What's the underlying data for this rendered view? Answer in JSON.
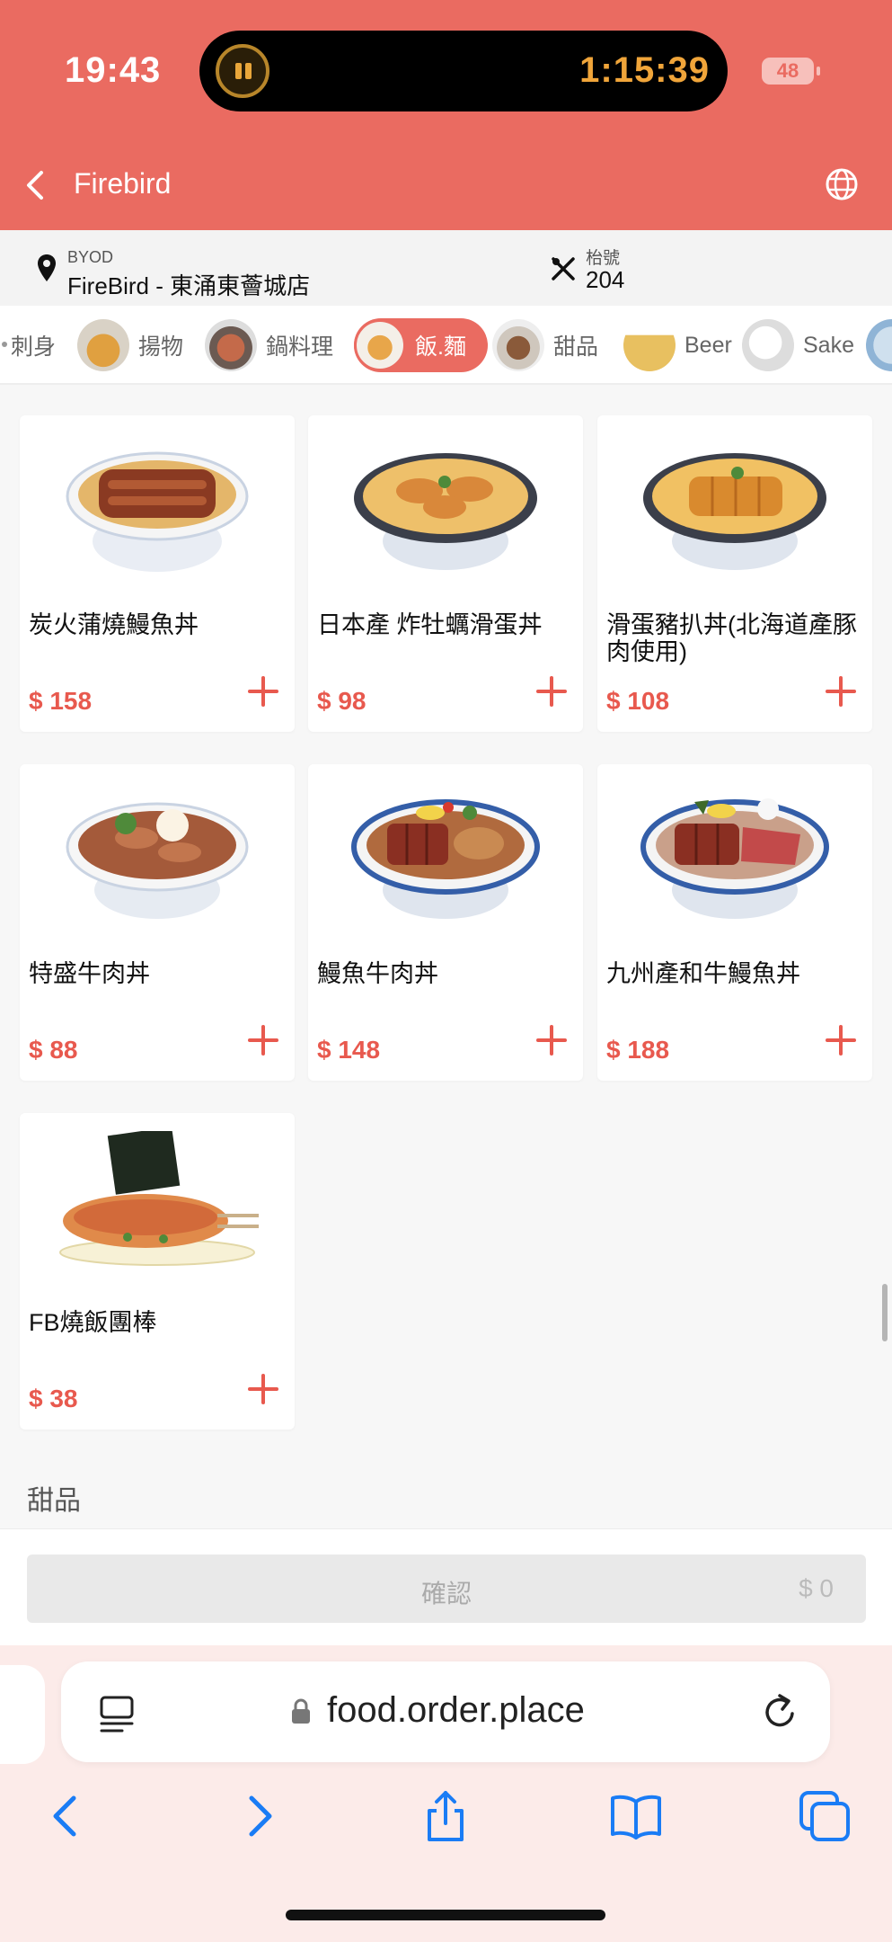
{
  "status_bar": {
    "time": "19:43",
    "timer": "1:15:39",
    "battery": "48"
  },
  "header": {
    "title": "Firebird"
  },
  "info": {
    "byod_label": "BYOD",
    "store_name": "FireBird - 東涌東薈城店",
    "table_label": "枱號",
    "table_number": "204"
  },
  "categories": [
    {
      "label": "刺身",
      "active": false
    },
    {
      "label": "揚物",
      "active": false
    },
    {
      "label": "鍋料理",
      "active": false
    },
    {
      "label": "飯.麵",
      "active": true
    },
    {
      "label": "甜品",
      "active": false
    },
    {
      "label": "Beer",
      "active": false
    },
    {
      "label": "Sake",
      "active": false
    }
  ],
  "products": [
    {
      "name": "炭火蒲燒鰻魚丼",
      "price": "$ 158"
    },
    {
      "name": "日本產 炸牡蠣滑蛋丼",
      "price": "$ 98"
    },
    {
      "name": "滑蛋豬扒丼(北海道產豚肉使用)",
      "price": "$ 108"
    },
    {
      "name": "特盛牛肉丼",
      "price": "$ 88"
    },
    {
      "name": "鰻魚牛肉丼",
      "price": "$ 148"
    },
    {
      "name": "九州產和牛鰻魚丼",
      "price": "$ 188"
    },
    {
      "name": "FB燒飯團棒",
      "price": "$ 38"
    }
  ],
  "next_section": "甜品",
  "confirm": {
    "label": "確認",
    "amount": "$ 0"
  },
  "browser": {
    "url": "food.order.place"
  },
  "icons": {
    "back": "chevron-left-icon",
    "globe": "globe-icon",
    "pin": "location-pin-icon",
    "table": "cutlery-icon",
    "add": "plus-icon",
    "lock": "lock-icon",
    "reader": "reader-icon",
    "reload": "reload-icon",
    "share": "share-icon",
    "bookmarks": "book-icon",
    "tabs": "tabs-icon"
  },
  "colors": {
    "brand": "#ea6b61",
    "price": "#e8594e",
    "ios_blue": "#1a7cf5"
  }
}
